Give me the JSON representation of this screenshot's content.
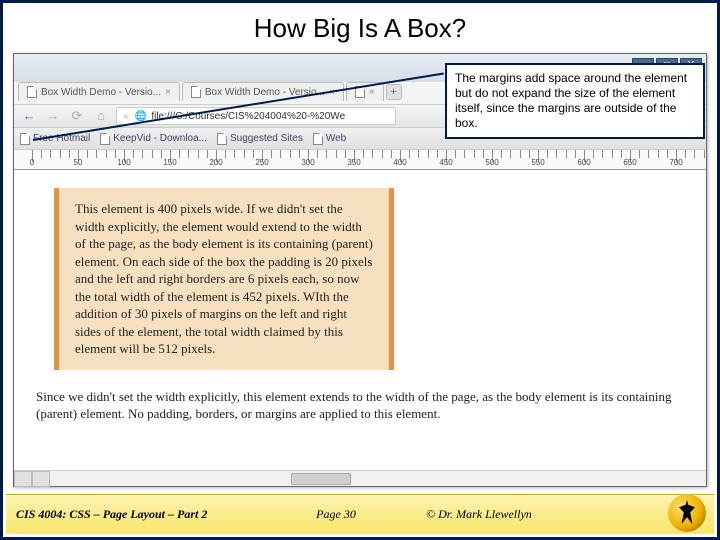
{
  "title": "How Big Is A Box?",
  "callout": "The margins add space around the element but do not expand the size of the element itself, since the margins are outside of the box.",
  "win": {
    "min": "—",
    "max": "□",
    "close": "X"
  },
  "tabs": [
    {
      "label": "Box Width Demo - Versio..."
    },
    {
      "label": "Box Width Demo - Versio..."
    },
    {
      "label": ""
    }
  ],
  "nav": {
    "back": "←",
    "fwd": "→",
    "reload": "⟳",
    "home": "⌂"
  },
  "address": {
    "scheme": "file:///C:/Courses/CIS%204004%20-%20We",
    "icon": "🌐"
  },
  "bookmarks": [
    "Free Hotmail",
    "KeepVid - Downloa...",
    "Suggested Sites",
    "Web"
  ],
  "ruler": [
    0,
    50,
    100,
    150,
    200,
    250,
    300,
    350,
    400,
    450,
    500,
    550,
    600,
    650,
    700
  ],
  "box1": "This element is 400 pixels wide. If we didn't set the width explicitly, the element would extend to the width of the page, as the body element is its containing (parent) element. On each side of the box the padding is 20 pixels and the left and right borders are 6 pixels each, so now the total width of the element is 452 pixels. WIth the addition of 30 pixels of margins on the left and right sides of the element, the total width claimed by this element will be 512 pixels.",
  "box2": "Since we didn't set the width explicitly, this element extends to the width of the page, as the body element is its containing (parent) element. No padding, borders, or margins are applied to this element.",
  "footer": {
    "course": "CIS 4004: CSS – Page Layout – Part 2",
    "page": "Page 30",
    "author": "© Dr. Mark Llewellyn"
  }
}
